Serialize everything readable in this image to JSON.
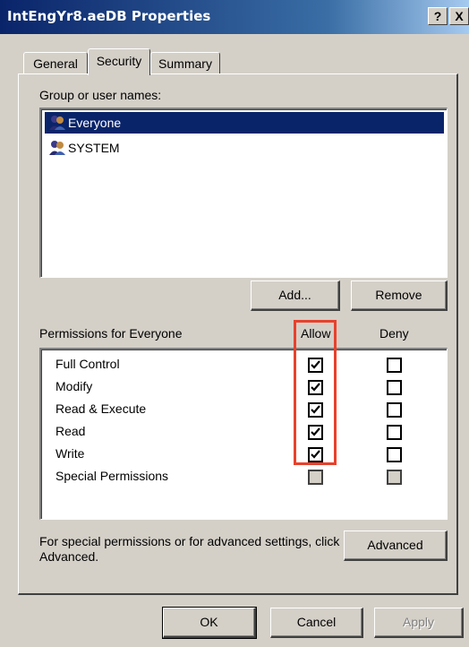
{
  "window": {
    "title": "IntEngYr8.aeDB Properties",
    "help_button": "?",
    "close_button": "X"
  },
  "tabs": [
    {
      "label": "General",
      "active": false
    },
    {
      "label": "Security",
      "active": true
    },
    {
      "label": "Summary",
      "active": false
    }
  ],
  "group": {
    "label": "Group or user names:",
    "users": [
      {
        "name": "Everyone",
        "selected": true,
        "icon": "users-group-icon"
      },
      {
        "name": "SYSTEM",
        "selected": false,
        "icon": "users-group-icon"
      }
    ],
    "add_label": "Add...",
    "remove_label": "Remove"
  },
  "permissions": {
    "header": "Permissions for Everyone",
    "allow_header": "Allow",
    "deny_header": "Deny",
    "rows": [
      {
        "label": "Full Control",
        "allow": "checked",
        "deny": "unchecked"
      },
      {
        "label": "Modify",
        "allow": "checked",
        "deny": "unchecked"
      },
      {
        "label": "Read & Execute",
        "allow": "checked",
        "deny": "unchecked"
      },
      {
        "label": "Read",
        "allow": "checked",
        "deny": "unchecked"
      },
      {
        "label": "Write",
        "allow": "checked",
        "deny": "unchecked"
      },
      {
        "label": "Special Permissions",
        "allow": "disabled",
        "deny": "disabled"
      }
    ]
  },
  "advanced": {
    "text": "For special permissions or for advanced settings, click Advanced.",
    "button_label": "Advanced"
  },
  "footer": {
    "ok_label": "OK",
    "cancel_label": "Cancel",
    "apply_label": "Apply",
    "apply_enabled": false
  },
  "colors": {
    "titlebar": "#0a246a",
    "dialog_bg": "#d4d0c8",
    "selection": "#0a246a",
    "annotation": "#e8412c"
  }
}
